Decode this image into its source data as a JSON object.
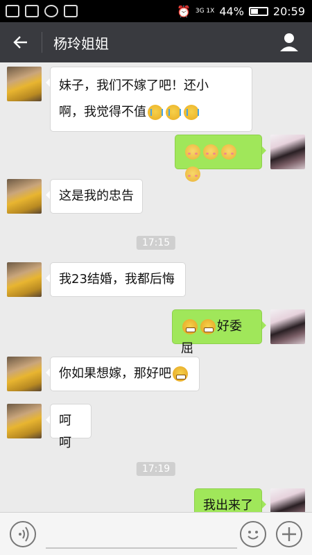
{
  "status_bar": {
    "network": "3G",
    "signal_label": "3G 1X",
    "battery": "44%",
    "battery_level": 0.44,
    "time": "20:59"
  },
  "header": {
    "title": "杨玲姐姐",
    "back_icon": "arrow-left-icon",
    "profile_icon": "person-icon"
  },
  "messages": [
    {
      "side": "left",
      "lines": [
        "妹子，我们不嫁了吧！还小",
        "啊，我觉得不值"
      ],
      "emoji": "cry"
    },
    {
      "side": "right",
      "emoji": "shy"
    },
    {
      "side": "left",
      "text": "这是我的忠告"
    },
    {
      "side": "left",
      "text": "我23结婚，我都后悔"
    },
    {
      "side": "right",
      "text": "好委屈",
      "emoji": "grimace"
    },
    {
      "side": "left",
      "text": "你如果想嫁，那好吧",
      "emoji": "grimace"
    },
    {
      "side": "left",
      "text": "呵呵"
    },
    {
      "side": "right",
      "text": "我出来了"
    }
  ],
  "timestamps": [
    "17:15",
    "17:19"
  ],
  "input_bar": {
    "voice_icon": "voice-icon",
    "emoji_icon": "emoji-icon",
    "plus_icon": "plus-icon"
  },
  "colors": {
    "header_bg": "#393a3f",
    "chat_bg": "#ebebeb",
    "my_bubble": "#a0e75a",
    "their_bubble": "#ffffff"
  }
}
